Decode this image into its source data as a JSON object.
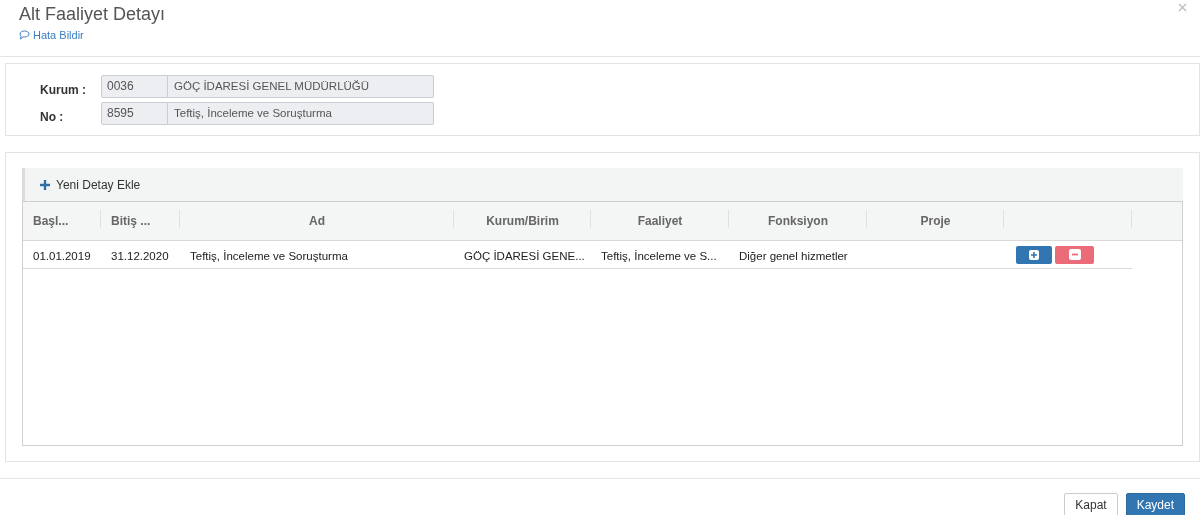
{
  "dialog": {
    "title": "Alt Faaliyet Detayı",
    "report_link": "Hata Bildir"
  },
  "form": {
    "fields": [
      {
        "label": "Kurum :",
        "code": "0036",
        "name": "GÖÇ İDARESİ GENEL MÜDÜRLÜĞÜ"
      },
      {
        "label": "No :",
        "code": "8595",
        "name": "Teftiş, İnceleme ve Soruşturma"
      }
    ]
  },
  "toolbar": {
    "add_label": "Yeni Detay Ekle"
  },
  "table": {
    "columns": [
      "Başl...",
      "Bitiş ...",
      "Ad",
      "Kurum/Birim",
      "Faaliyet",
      "Fonksiyon",
      "Proje"
    ],
    "rows": [
      {
        "cells": [
          "01.01.2019",
          "31.12.2020",
          "Teftiş, İnceleme ve Soruşturma",
          "GÖÇ İDARESİ GENE...",
          "Teftiş, İnceleme ve S...",
          "Diğer genel hizmetler",
          ""
        ]
      }
    ]
  },
  "footer": {
    "buttons": [
      {
        "label": "Kapat",
        "kind": "default"
      },
      {
        "label": "Kaydet",
        "kind": "primary"
      }
    ]
  }
}
